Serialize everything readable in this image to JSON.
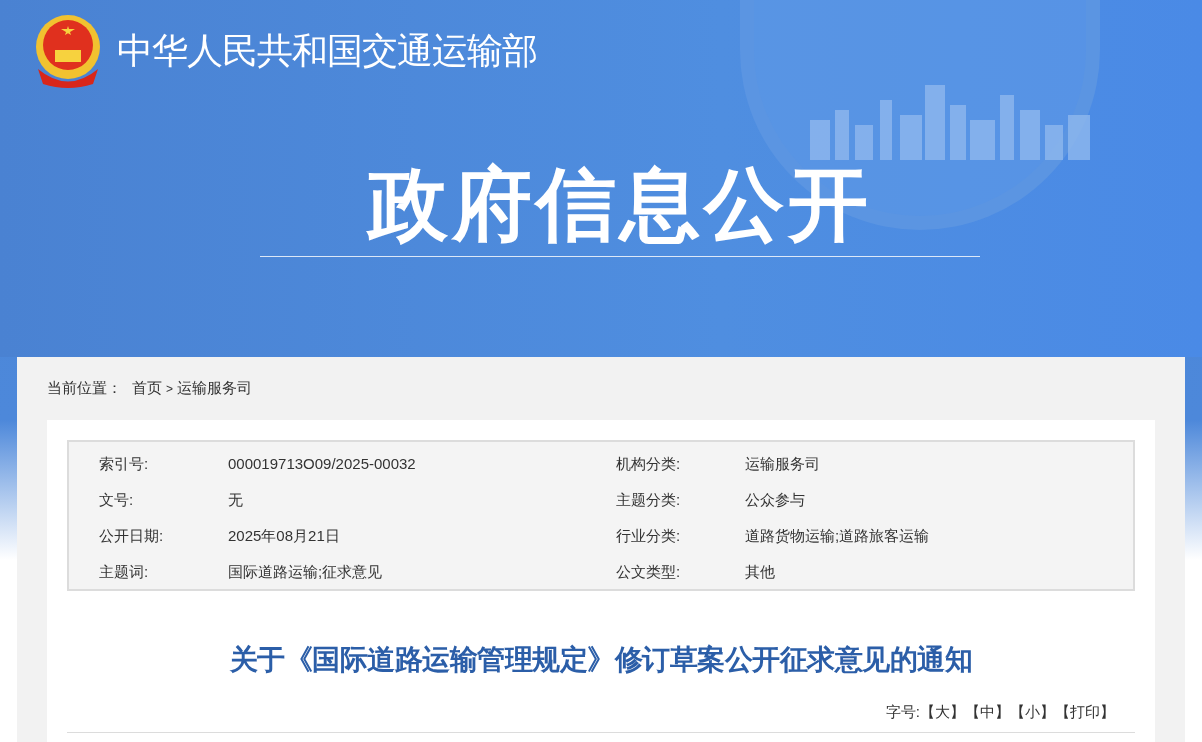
{
  "site_title": "中华人民共和国交通运输部",
  "banner_title": "政府信息公开",
  "breadcrumb": {
    "label": "当前位置：",
    "items": [
      "首页",
      "运输服务司"
    ],
    "separator": ">"
  },
  "info": [
    {
      "label": "索引号:",
      "value": "000019713O09/2025-00032"
    },
    {
      "label": "机构分类:",
      "value": "运输服务司"
    },
    {
      "label": "文号:",
      "value": "无"
    },
    {
      "label": "主题分类:",
      "value": "公众参与"
    },
    {
      "label": "公开日期:",
      "value": "2025年08月21日"
    },
    {
      "label": "行业分类:",
      "value": "道路货物运输;道路旅客运输"
    },
    {
      "label": "主题词:",
      "value": "国际道路运输;征求意见"
    },
    {
      "label": "公文类型:",
      "value": "其他"
    }
  ],
  "article_title": "关于《国际道路运输管理规定》修订草案公开征求意见的通知",
  "font_size": {
    "label": "字号:",
    "options": [
      "【大】",
      "【中】",
      "【小】",
      "【打印】"
    ]
  }
}
